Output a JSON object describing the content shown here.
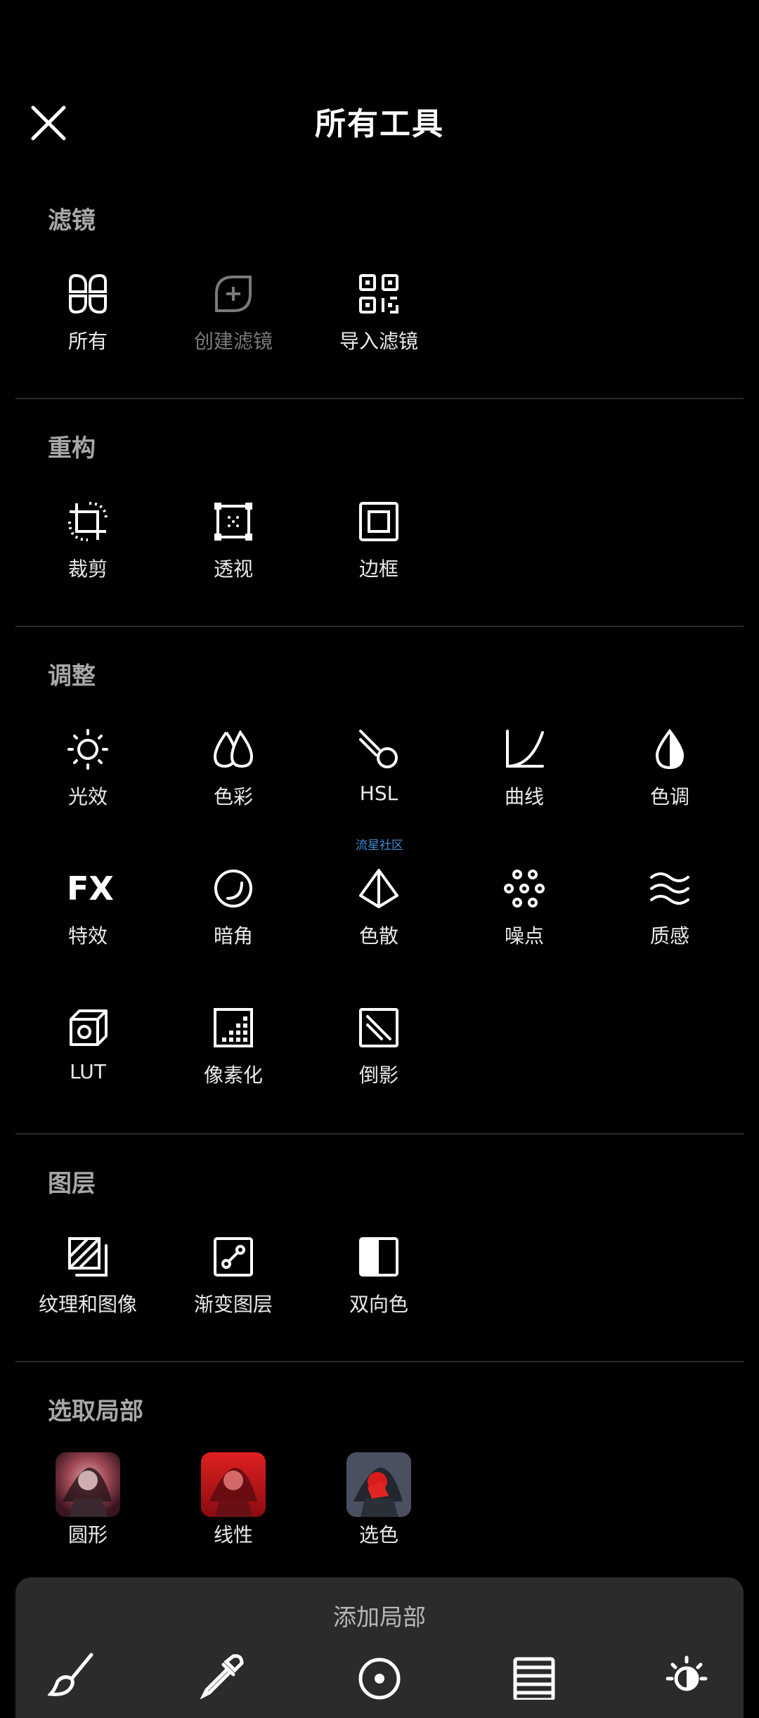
{
  "header": {
    "title": "所有工具"
  },
  "sections": {
    "filters": {
      "title": "滤镜",
      "items": [
        "所有",
        "创建滤镜",
        "导入滤镜"
      ]
    },
    "reframe": {
      "title": "重构",
      "items": [
        "裁剪",
        "透视",
        "边框"
      ]
    },
    "adjust": {
      "title": "调整",
      "items": [
        "光效",
        "色彩",
        "HSL",
        "曲线",
        "色调",
        "特效",
        "暗角",
        "色散",
        "噪点",
        "质感",
        "LUT",
        "像素化",
        "倒影"
      ],
      "fx_text": "FX"
    },
    "layers": {
      "title": "图层",
      "items": [
        "纹理和图像",
        "渐变图层",
        "双向色"
      ]
    },
    "local": {
      "title": "选取局部",
      "items": [
        "圆形",
        "线性",
        "选色"
      ]
    }
  },
  "watermark": "流星社区",
  "bottom_panel": {
    "title": "添加局部"
  },
  "colors": {
    "background": "#000000",
    "section_title": "#a8a8a8",
    "label": "#ebebeb",
    "disabled": "#7a7a7a",
    "panel": "#2b2b2d",
    "watermark": "#3e8bd6"
  }
}
